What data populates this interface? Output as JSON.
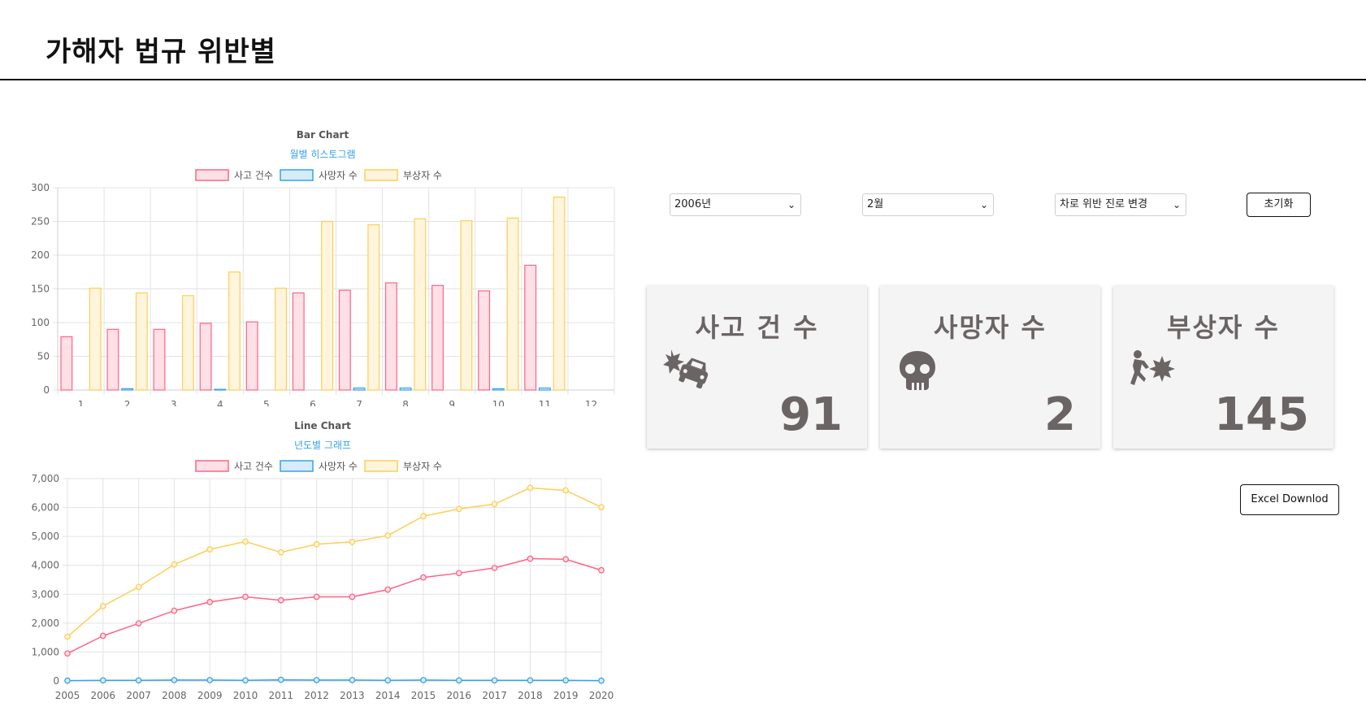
{
  "page": {
    "title": "가해자 법규 위반별"
  },
  "filters": {
    "year": "2006년",
    "month": "2월",
    "violation": "차로 위반 진로 변경",
    "reset_label": "초기화"
  },
  "cards": [
    {
      "title": "사고 건 수",
      "value": "91",
      "icon": "car-crash-icon"
    },
    {
      "title": "사망자 수",
      "value": "2",
      "icon": "skull-icon"
    },
    {
      "title": "부상자 수",
      "value": "145",
      "icon": "person-hit-icon"
    }
  ],
  "excel_label": "Excel Downlod",
  "colors": {
    "accidents_stroke": "#ff6384",
    "accidents_fill": "#ffe0e6",
    "deaths_stroke": "#36a2eb",
    "deaths_fill": "#d7ecfb",
    "injuries_stroke": "#ffcd56",
    "injuries_fill": "#fff5dd",
    "card_text": "#6b6464",
    "subtitle": "#36a2eb"
  },
  "chart_data": [
    {
      "type": "bar",
      "title": "Bar Chart",
      "subtitle": "월별 히스토그램",
      "legend_position": "top",
      "grid": true,
      "categories": [
        "1",
        "2",
        "3",
        "4",
        "5",
        "6",
        "7",
        "8",
        "9",
        "10",
        "11",
        "12"
      ],
      "ylim": [
        0,
        300
      ],
      "yticks": [
        0,
        50,
        100,
        150,
        200,
        250,
        300
      ],
      "series": [
        {
          "name": "사고 건수",
          "values": [
            79,
            90,
            90,
            99,
            101,
            144,
            148,
            159,
            155,
            147,
            185,
            0
          ]
        },
        {
          "name": "사망자 수",
          "values": [
            0,
            2,
            0,
            1,
            0,
            0,
            3,
            3,
            0,
            2,
            3,
            0
          ]
        },
        {
          "name": "부상자 수",
          "values": [
            151,
            144,
            140,
            175,
            151,
            250,
            245,
            254,
            251,
            255,
            286,
            0
          ]
        }
      ]
    },
    {
      "type": "line",
      "title": "Line Chart",
      "subtitle": "년도별 그래프",
      "legend_position": "top",
      "grid": true,
      "x": [
        "2005",
        "2006",
        "2007",
        "2008",
        "2009",
        "2010",
        "2011",
        "2012",
        "2013",
        "2014",
        "2015",
        "2016",
        "2017",
        "2018",
        "2019",
        "2020"
      ],
      "ylim": [
        0,
        7000
      ],
      "yticks": [
        "0",
        "1,000",
        "2,000",
        "3,000",
        "4,000",
        "5,000",
        "6,000",
        "7,000"
      ],
      "series": [
        {
          "name": "사고 건수",
          "values": [
            950,
            1560,
            1990,
            2430,
            2730,
            2910,
            2790,
            2910,
            2910,
            3160,
            3580,
            3730,
            3910,
            4230,
            4210,
            3830
          ]
        },
        {
          "name": "사망자 수",
          "values": [
            10,
            20,
            20,
            30,
            30,
            20,
            40,
            30,
            30,
            20,
            30,
            20,
            20,
            20,
            20,
            10
          ]
        },
        {
          "name": "부상자 수",
          "values": [
            1530,
            2590,
            3250,
            4030,
            4550,
            4820,
            4450,
            4730,
            4810,
            5030,
            5700,
            5950,
            6120,
            6680,
            6590,
            6010
          ]
        }
      ]
    }
  ]
}
